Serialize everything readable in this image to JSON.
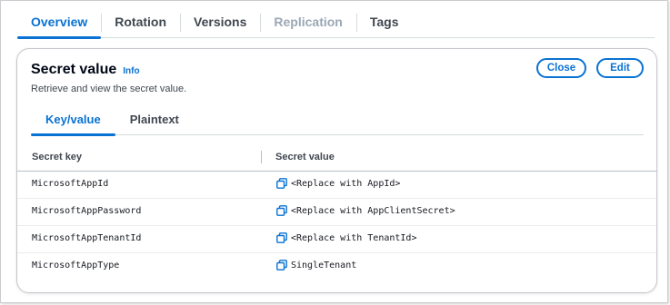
{
  "tabs": [
    {
      "label": "Overview",
      "state": "active"
    },
    {
      "label": "Rotation",
      "state": "normal"
    },
    {
      "label": "Versions",
      "state": "normal"
    },
    {
      "label": "Replication",
      "state": "disabled"
    },
    {
      "label": "Tags",
      "state": "normal"
    }
  ],
  "panel": {
    "title": "Secret value",
    "info_label": "Info",
    "description": "Retrieve and view the secret value.",
    "close_label": "Close",
    "edit_label": "Edit"
  },
  "inner_tabs": [
    {
      "label": "Key/value",
      "state": "active"
    },
    {
      "label": "Plaintext",
      "state": "normal"
    }
  ],
  "table": {
    "columns": [
      "Secret key",
      "Secret value"
    ],
    "rows": [
      {
        "key": "MicrosoftAppId",
        "value": "<Replace with AppId>",
        "icon": "copy-icon"
      },
      {
        "key": "MicrosoftAppPassword",
        "value": "<Replace with AppClientSecret>",
        "icon": "copy-icon"
      },
      {
        "key": "MicrosoftAppTenantId",
        "value": "<Replace with TenantId>",
        "icon": "copy-icon"
      },
      {
        "key": "MicrosoftAppType",
        "value": "SingleTenant",
        "icon": "copy-icon"
      }
    ]
  },
  "colors": {
    "accent": "#0972d3",
    "text": "#16191f",
    "disabled": "#9ba7b6",
    "border": "#d5dbdb"
  }
}
